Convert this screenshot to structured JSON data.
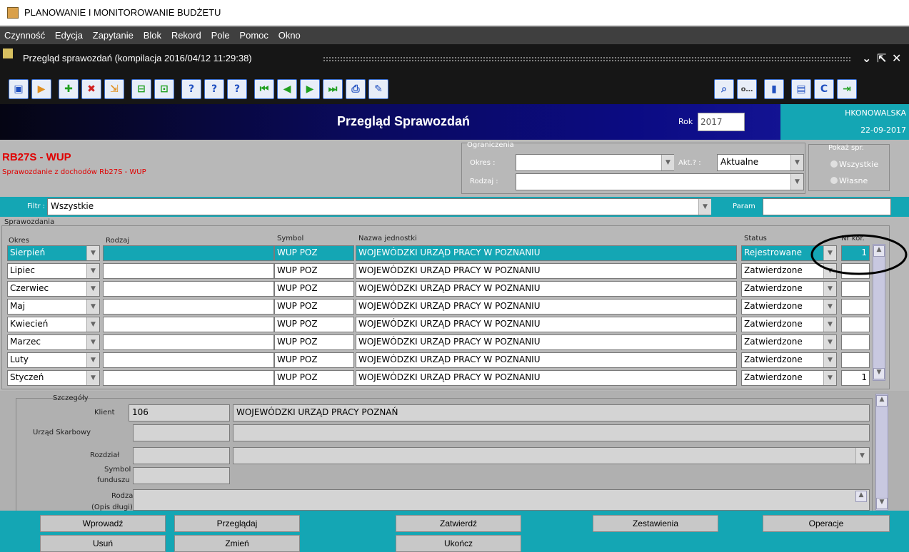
{
  "app": {
    "title": "PLANOWANIE I MONITOROWANIE BUDŻETU"
  },
  "menu": [
    "Czynność",
    "Edycja",
    "Zapytanie",
    "Blok",
    "Rekord",
    "Pole",
    "Pomoc",
    "Okno"
  ],
  "window": {
    "title": "Przegląd sprawozdań (kompilacja 2016/04/12 11:29:38)"
  },
  "header": {
    "title": "Przegląd Sprawozdań",
    "rok_label": "Rok",
    "rok_value": "2017",
    "user": "HKONOWALSKA",
    "date": "22-09-2017"
  },
  "report": {
    "code": "RB27S - WUP",
    "description": "Sprawozdanie z dochodów Rb27S - WUP"
  },
  "ograniczenia": {
    "title": "Ograniczenia",
    "okres_label": "Okres :",
    "okres_value": "",
    "akt_label": "Akt.? :",
    "akt_value": "Aktualne",
    "rodzaj_label": "Rodzaj :",
    "rodzaj_value": ""
  },
  "pokaz": {
    "title": "Pokaż spr.",
    "opt1": "Wszystkie",
    "opt2": "Własne"
  },
  "filtr": {
    "label": "Filtr :",
    "value": "Wszystkie",
    "param_label": "Param",
    "param_value": ""
  },
  "table": {
    "section": "Sprawozdania",
    "headers": {
      "okres": "Okres",
      "rodzaj": "Rodzaj",
      "symbol": "Symbol",
      "nazwa": "Nazwa jednostki",
      "status": "Status",
      "nrkor": "Nr kor."
    },
    "rows": [
      {
        "okres": "Sierpień",
        "rodzaj": "",
        "symbol": "WUP POZ",
        "nazwa": "WOJEWÓDZKI URZĄD PRACY W POZNANIU",
        "status": "Rejestrowane",
        "nrkor": "1"
      },
      {
        "okres": "Lipiec",
        "rodzaj": "",
        "symbol": "WUP POZ",
        "nazwa": "WOJEWÓDZKI URZĄD PRACY W POZNANIU",
        "status": "Zatwierdzone",
        "nrkor": ""
      },
      {
        "okres": "Czerwiec",
        "rodzaj": "",
        "symbol": "WUP POZ",
        "nazwa": "WOJEWÓDZKI URZĄD PRACY W POZNANIU",
        "status": "Zatwierdzone",
        "nrkor": ""
      },
      {
        "okres": "Maj",
        "rodzaj": "",
        "symbol": "WUP POZ",
        "nazwa": "WOJEWÓDZKI URZĄD PRACY W POZNANIU",
        "status": "Zatwierdzone",
        "nrkor": ""
      },
      {
        "okres": "Kwiecień",
        "rodzaj": "",
        "symbol": "WUP POZ",
        "nazwa": "WOJEWÓDZKI URZĄD PRACY W POZNANIU",
        "status": "Zatwierdzone",
        "nrkor": ""
      },
      {
        "okres": "Marzec",
        "rodzaj": "",
        "symbol": "WUP POZ",
        "nazwa": "WOJEWÓDZKI URZĄD PRACY W POZNANIU",
        "status": "Zatwierdzone",
        "nrkor": ""
      },
      {
        "okres": "Luty",
        "rodzaj": "",
        "symbol": "WUP POZ",
        "nazwa": "WOJEWÓDZKI URZĄD PRACY W POZNANIU",
        "status": "Zatwierdzone",
        "nrkor": ""
      },
      {
        "okres": "Styczeń",
        "rodzaj": "",
        "symbol": "WUP POZ",
        "nazwa": "WOJEWÓDZKI URZĄD PRACY W POZNANIU",
        "status": "Zatwierdzone",
        "nrkor": "1"
      }
    ]
  },
  "szczegoly": {
    "title": "Szczegóły",
    "klient_label": "Klient",
    "klient_id": "106",
    "klient_name": "WOJEWÓDZKI URZĄD PRACY POZNAŃ",
    "us_label": "Urząd Skarbowy",
    "rozdzial_label": "Rozdział",
    "symbol_label1": "Symbol",
    "symbol_label2": "funduszu",
    "rodzaj_label1": "Rodzaj",
    "rodzaj_label2": "(Opis długi)"
  },
  "buttons": {
    "wprowadz": "Wprowadź",
    "przegladaj": "Przeglądaj",
    "zatwierdz": "Zatwierdź",
    "zestawienia": "Zestawienia",
    "operacje": "Operacje",
    "usun": "Usuń",
    "zmien": "Zmień",
    "ukoncz": "Ukończ"
  },
  "colors": {
    "teal": "#14a6b4",
    "header_blue": "#0b0b83",
    "red_title": "#e00000"
  }
}
